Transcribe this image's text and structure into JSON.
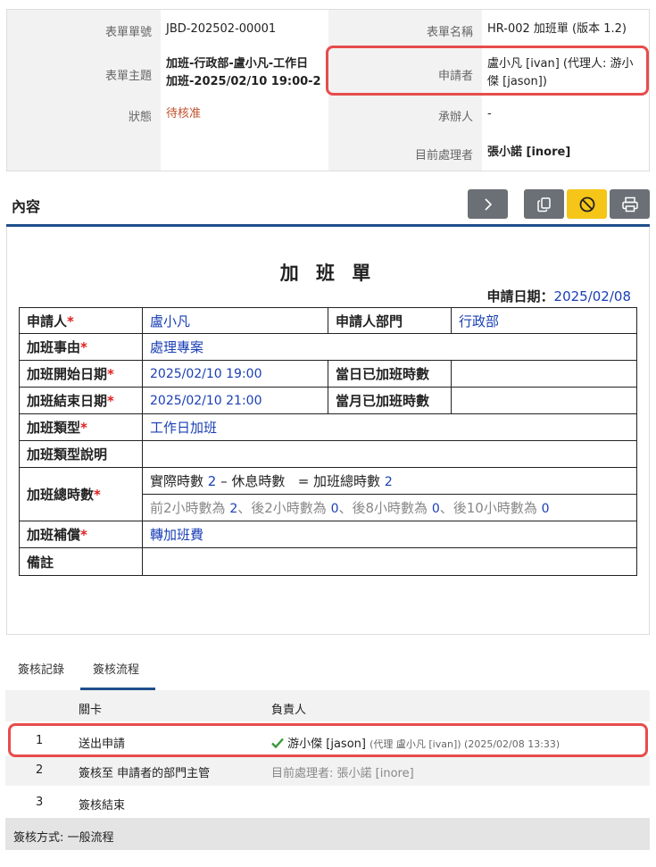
{
  "header": {
    "form_no_label": "表單單號",
    "form_no": "JBD-202502-00001",
    "form_name_label": "表單名稱",
    "form_name": "HR-002 加班單 (版本 1.2)",
    "subject_label": "表單主題",
    "subject_line1": "加班-行政部-盧小凡-工作日",
    "subject_line2": "加班-2025/02/10 19:00-2",
    "applicant_label": "申請者",
    "applicant_line1": "盧小凡 [ivan] (代理人: 游小",
    "applicant_line2": "傑 [jason])",
    "status_label": "狀態",
    "status": "待核准",
    "handler_label": "承辦人",
    "handler": "-",
    "current_label": "目前處理者",
    "current": "張小諾 [inore]"
  },
  "section": {
    "title": "內容"
  },
  "toolbar": {
    "icons": [
      "chevron-right-icon",
      "copy-icon",
      "ban-icon",
      "print-icon"
    ]
  },
  "form": {
    "title": "加 班 單",
    "apply_date_label": "申請日期：",
    "apply_date": "2025/02/08",
    "applicant_label": "申請人",
    "applicant": "盧小凡",
    "dept_label": "申請人部門",
    "dept": "行政部",
    "reason_label": "加班事由",
    "reason": "處理專案",
    "start_label": "加班開始日期",
    "start": "2025/02/10 19:00",
    "day_hours_label": "當日已加班時數",
    "end_label": "加班結束日期",
    "end": "2025/02/10 21:00",
    "month_hours_label": "當月已加班時數",
    "type_label": "加班類型",
    "type": "工作日加班",
    "type_desc_label": "加班類型說明",
    "total_label": "加班總時數",
    "actual_label": "實際時數",
    "actual": "2",
    "rest_label": "– 休息時數",
    "total_eq_label": "= 加班總時數",
    "total": "2",
    "first2_label": "前2小時數為",
    "first2": "2",
    "after2_label": "、後2小時數為",
    "after2": "0",
    "after8_label": "、後8小時數為",
    "after8": "0",
    "after10_label": "、後10小時數為",
    "after10": "0",
    "comp_label": "加班補償",
    "comp": "轉加班費",
    "note_label": "備註"
  },
  "tabs": {
    "records": "簽核記錄",
    "flow": "簽核流程"
  },
  "flow": {
    "col_stage": "關卡",
    "col_owner": "負責人",
    "rows": [
      {
        "no": "1",
        "stage": "送出申請",
        "owner": "游小傑 [jason]",
        "detail": "(代理 盧小凡 [ivan]) (2025/02/08 13:33)"
      },
      {
        "no": "2",
        "stage": "簽核至 申請者的部門主管",
        "owner": "目前處理者: 張小諾 [inore]"
      },
      {
        "no": "3",
        "stage": "簽核結束",
        "owner": ""
      }
    ],
    "method": "簽核方式: 一般流程"
  }
}
